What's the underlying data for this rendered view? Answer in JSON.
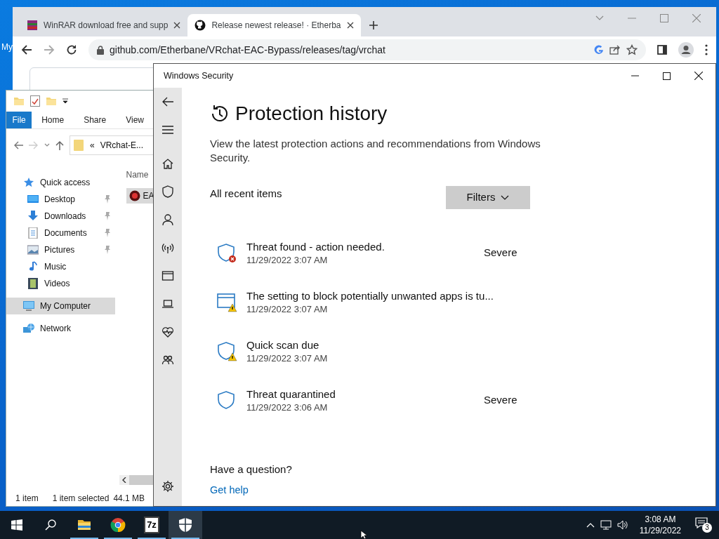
{
  "desktop": {
    "icon_labels": [
      "My"
    ]
  },
  "browser": {
    "tabs": [
      {
        "title": "WinRAR download free and supp",
        "kind": "winrar",
        "selected": false
      },
      {
        "title": "Release newest release! · Etherba",
        "kind": "github",
        "selected": true
      }
    ],
    "url": "github.com/Etherbane/VRchat-EAC-Bypass/releases/tag/vrchat"
  },
  "explorer": {
    "ribbon_tabs": [
      {
        "label": "File",
        "kind": "file"
      },
      {
        "label": "Home",
        "kind": "tab"
      },
      {
        "label": "Share",
        "kind": "tab"
      },
      {
        "label": "View",
        "kind": "tab"
      }
    ],
    "address_marker": "«",
    "address": "VRchat-E...",
    "nav": [
      {
        "label": "Quick access",
        "kind": "star",
        "selected": false,
        "children": [
          {
            "label": "Desktop",
            "kind": "desktop",
            "pinned": true,
            "selected": false
          },
          {
            "label": "Downloads",
            "kind": "downloads",
            "pinned": true,
            "selected": false
          },
          {
            "label": "Documents",
            "kind": "documents",
            "pinned": true,
            "selected": false
          },
          {
            "label": "Pictures",
            "kind": "pictures",
            "pinned": true,
            "selected": false
          },
          {
            "label": "Music",
            "kind": "music",
            "pinned": false,
            "selected": false
          },
          {
            "label": "Videos",
            "kind": "videos",
            "pinned": false,
            "selected": false
          }
        ]
      },
      {
        "label": "My Computer",
        "kind": "computer",
        "selected": true
      },
      {
        "label": "Network",
        "kind": "network",
        "selected": false
      }
    ],
    "column_header": "Name",
    "files": [
      {
        "name": "EA",
        "selected": true
      }
    ],
    "status": [
      "1 item",
      "1 item selected",
      "44.1 MB"
    ]
  },
  "security": {
    "title": "Windows Security",
    "heading": "Protection history",
    "description": "View the latest protection actions and recommendations from Windows Security.",
    "section": "All recent items",
    "filter_button": "Filters",
    "items": [
      {
        "title": "Threat found - action needed.",
        "date": "11/29/2022 3:07 AM",
        "severity": "Severe",
        "kind": "threat"
      },
      {
        "title": "The setting to block potentially unwanted apps is tu...",
        "date": "11/29/2022 3:07 AM",
        "kind": "app-setting"
      },
      {
        "title": "Quick scan due",
        "date": "11/29/2022 3:07 AM",
        "kind": "scan"
      },
      {
        "title": "Threat quarantined",
        "date": "11/29/2022 3:06 AM",
        "severity": "Severe",
        "kind": "quarantine"
      }
    ],
    "question": "Have a question?",
    "help_link": "Get help"
  },
  "taskbar": {
    "apps": [
      {
        "kind": "explorer",
        "running": true,
        "selected": false
      },
      {
        "kind": "chrome",
        "running": true,
        "selected": false
      },
      {
        "kind": "archiver",
        "label": "7z",
        "running": true,
        "selected": false
      },
      {
        "kind": "security",
        "running": true,
        "selected": true
      }
    ],
    "time": "3:08 AM",
    "date": "11/29/2022",
    "notifications": "3"
  }
}
